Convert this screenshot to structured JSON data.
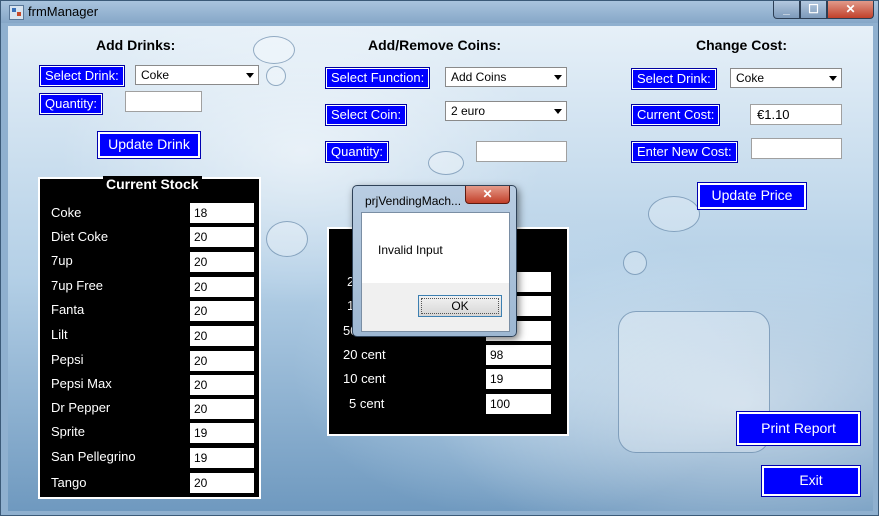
{
  "window": {
    "title": "frmManager"
  },
  "add_drinks": {
    "heading": "Add Drinks:",
    "select_label": "Select Drink:",
    "drink_value": "Coke",
    "quantity_label": "Quantity:",
    "quantity_value": "",
    "update_button": "Update Drink"
  },
  "coins": {
    "heading": "Add/Remove Coins:",
    "function_label": "Select Function:",
    "function_value": "Add Coins",
    "coin_label": "Select Coin:",
    "coin_value": "2 euro",
    "quantity_label": "Quantity:",
    "quantity_value": ""
  },
  "cost": {
    "heading": "Change Cost:",
    "select_label": "Select Drink:",
    "drink_value": "Coke",
    "current_label": "Current Cost:",
    "current_value": "€1.10",
    "new_label": "Enter New Cost:",
    "new_value": "",
    "update_button": "Update Price"
  },
  "stock": {
    "title": "Current Stock",
    "items": [
      {
        "name": "Coke",
        "value": "18"
      },
      {
        "name": "Diet Coke",
        "value": "20"
      },
      {
        "name": "7up",
        "value": "20"
      },
      {
        "name": "7up Free",
        "value": "20"
      },
      {
        "name": "Fanta",
        "value": "20"
      },
      {
        "name": "Lilt",
        "value": "20"
      },
      {
        "name": "Pepsi",
        "value": "20"
      },
      {
        "name": "Pepsi Max",
        "value": "20"
      },
      {
        "name": "Dr Pepper",
        "value": "20"
      },
      {
        "name": "Sprite",
        "value": "19"
      },
      {
        "name": "San Pellegrino",
        "value": "19"
      },
      {
        "name": "Tango",
        "value": "20"
      }
    ]
  },
  "coin_stock": {
    "items": [
      {
        "name": "2",
        "value": ""
      },
      {
        "name": "1",
        "value": ""
      },
      {
        "name": "50",
        "value": ""
      },
      {
        "name": "20 cent",
        "value": "98"
      },
      {
        "name": "10 cent",
        "value": "19"
      },
      {
        "name": "5 cent",
        "value": "100"
      }
    ]
  },
  "buttons": {
    "print": "Print Report",
    "exit": "Exit"
  },
  "dialog": {
    "title": "prjVendingMach...",
    "message": "Invalid Input",
    "ok": "OK",
    "close_glyph": "✕"
  },
  "window_controls": {
    "minimize": "_",
    "maximize": "☐",
    "close": "✕"
  }
}
